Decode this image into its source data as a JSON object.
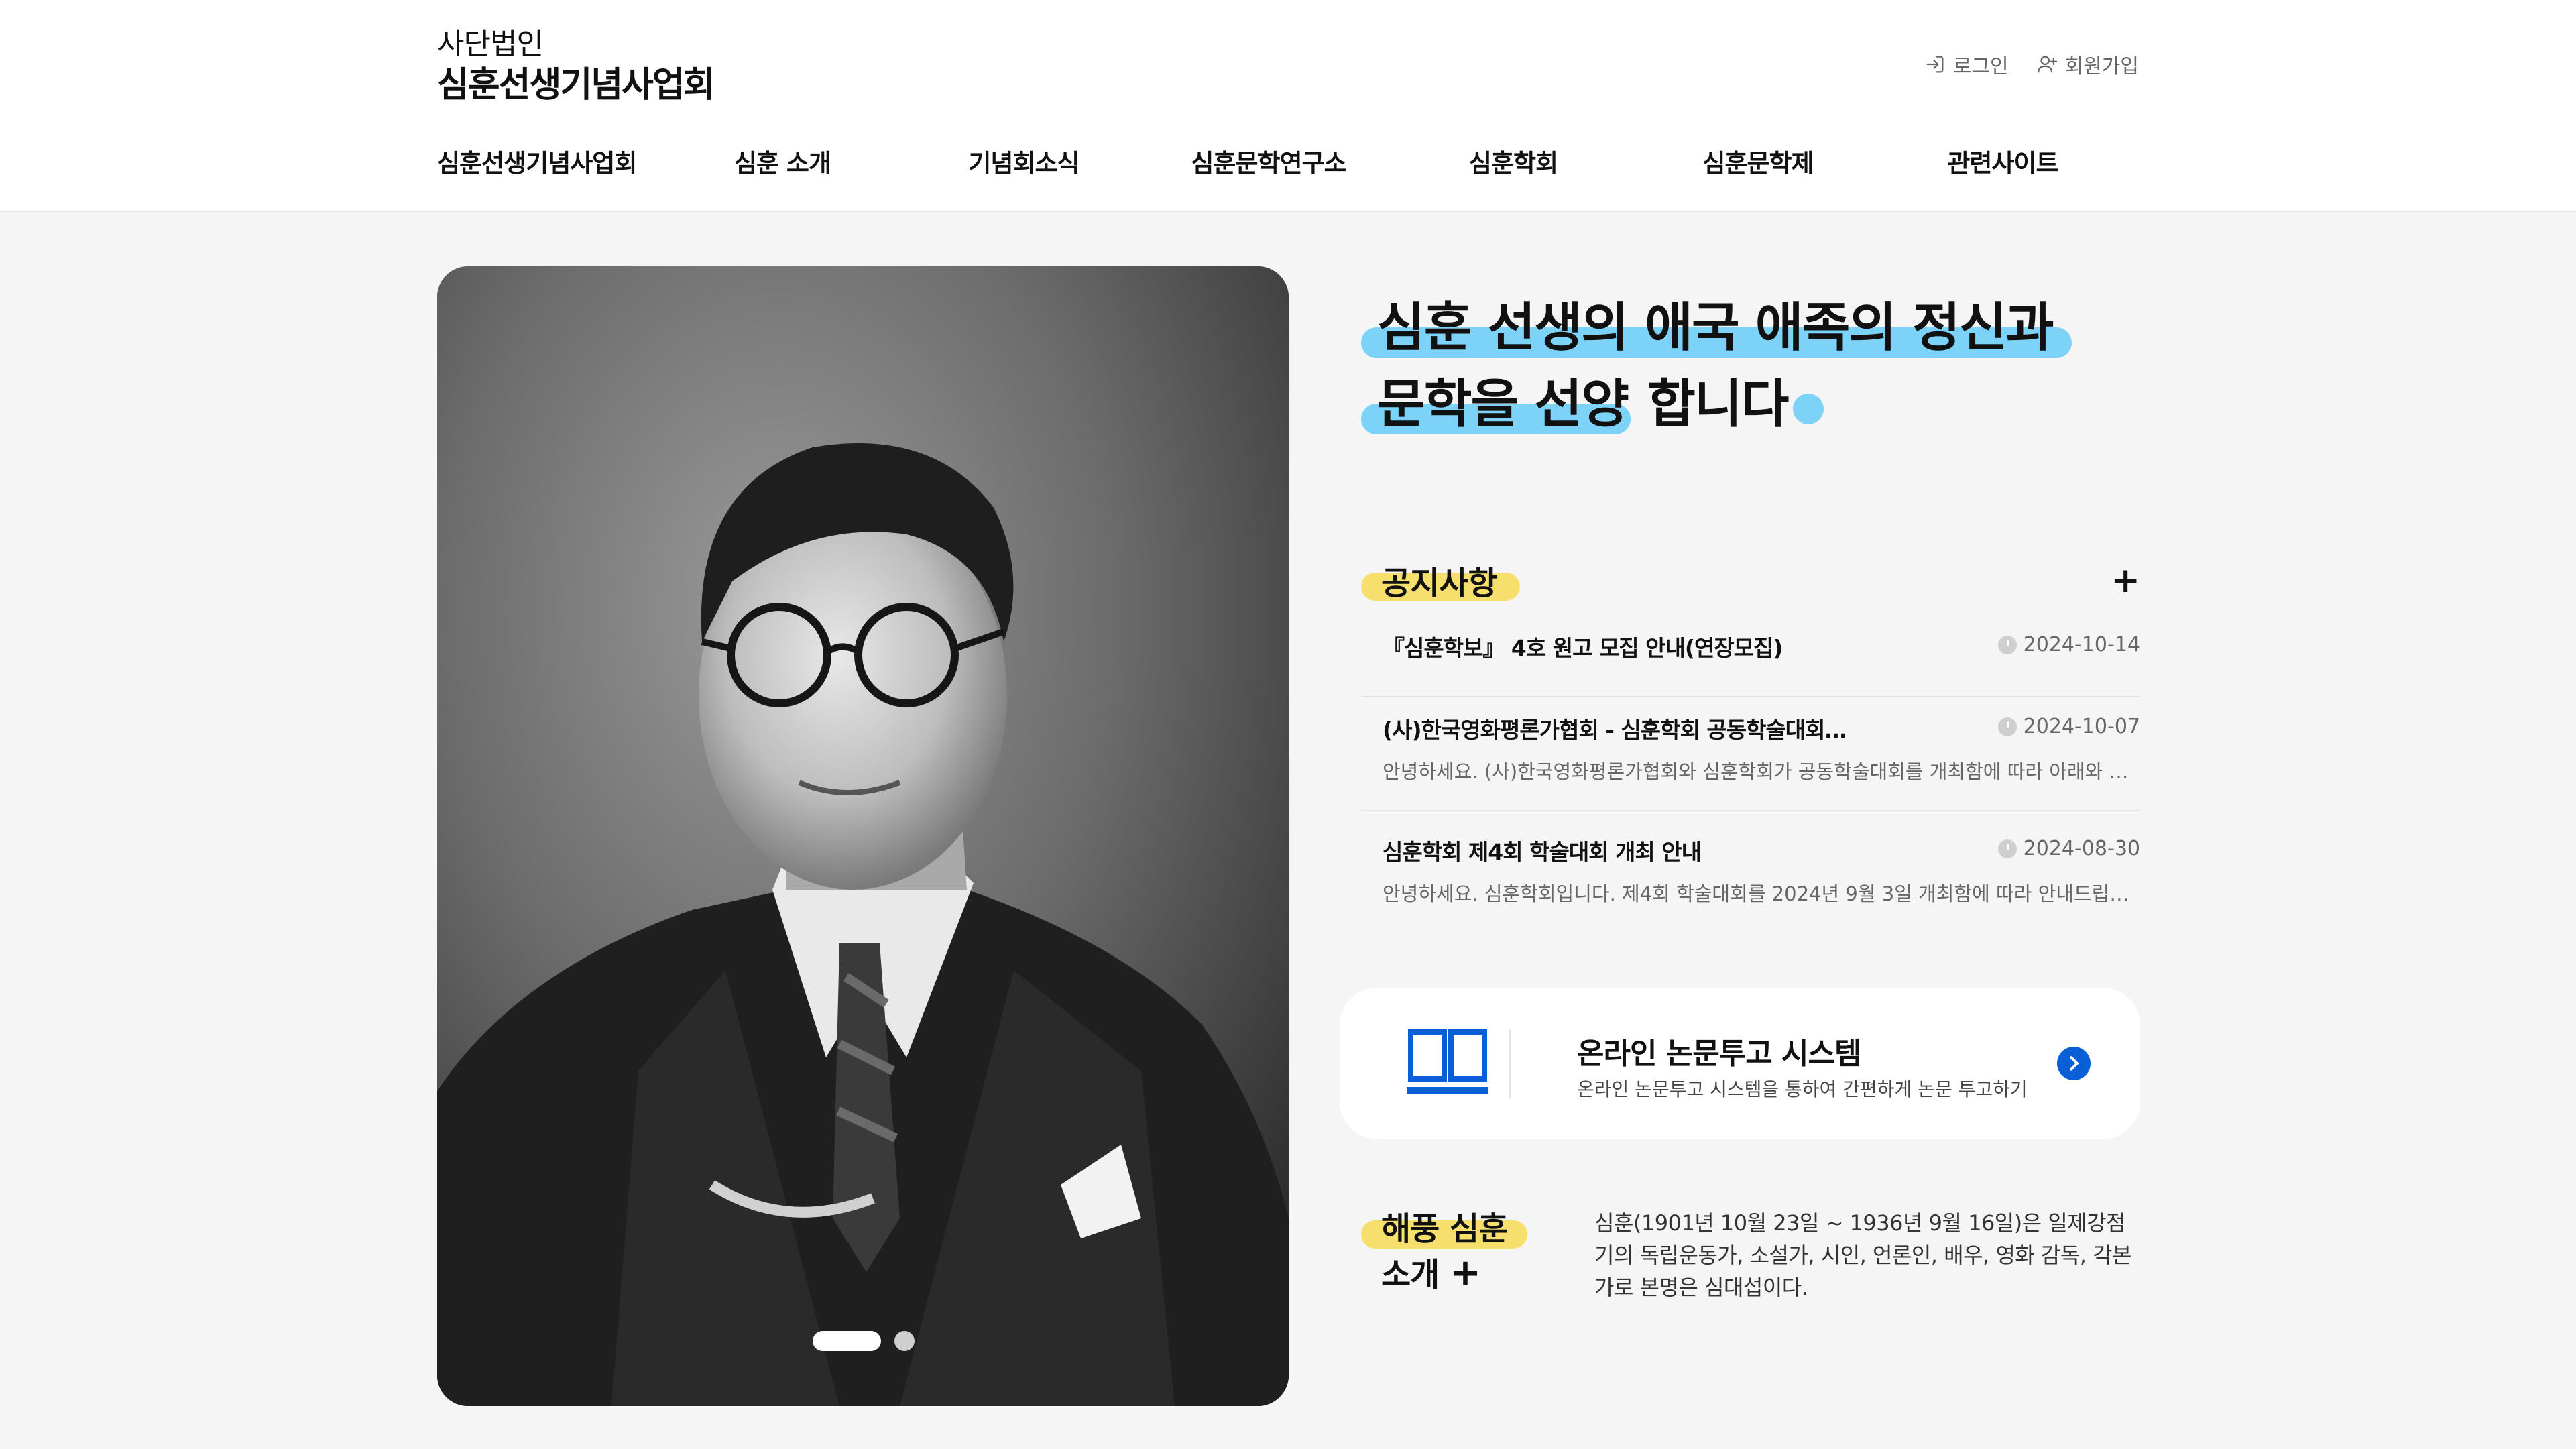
{
  "header": {
    "org_type": "사단법인",
    "org_name": "심훈선생기념사업회",
    "login": "로그인",
    "signup": "회원가입"
  },
  "nav": [
    "심훈선생기념사업회",
    "심훈 소개",
    "기념회소식",
    "심훈문학연구소",
    "심훈학회",
    "심훈문학제",
    "관련사이트"
  ],
  "hero": {
    "line1": "심훈 선생의 애국 애족의 정신과",
    "line2a": "문학을 선양",
    "line2b": " 합니다"
  },
  "notice": {
    "title": "공지사항",
    "more": "+",
    "items": [
      {
        "title": "『심훈학보』 4호 원고 모집 안내(연장모집)",
        "date": "2024-10-14",
        "summary": ""
      },
      {
        "title": "(사)한국영화평론가협회 - 심훈학회 공동학술대회…",
        "date": "2024-10-07",
        "summary": "안녕하세요. (사)한국영화평론가협회와 심훈학회가 공동학술대회를 개최함에 따라 아래와 …"
      },
      {
        "title": "심훈학회 제4회 학술대회 개최 안내",
        "date": "2024-08-30",
        "summary": "안녕하세요. 심훈학회입니다. 제4회 학술대회를 2024년 9월 3일 개최함에 따라 안내드립…"
      }
    ]
  },
  "submission": {
    "title": "온라인 논문투고 시스템",
    "desc": "온라인 논문투고 시스템을 통하여 간편하게 논문 투고하기"
  },
  "intro": {
    "title1": "해풍 심훈",
    "title2": "소개",
    "plus": "+",
    "text": "심훈(1901년 10월 23일 ~ 1936년 9월 16일)은 일제강점기의 독립운동가, 소설가, 시인, 언론인, 배우, 영화 감독, 각본가로 본명은 심대섭이다."
  },
  "slider": {
    "total": 2,
    "active": 1
  },
  "colors": {
    "blue_highlight": "#7dd3f7",
    "yellow_highlight": "#f7df6e",
    "accent_blue": "#0b5fd6"
  },
  "icons": [
    "login-icon",
    "signup-icon",
    "clock-icon",
    "book-icon",
    "arrow-right-icon"
  ]
}
